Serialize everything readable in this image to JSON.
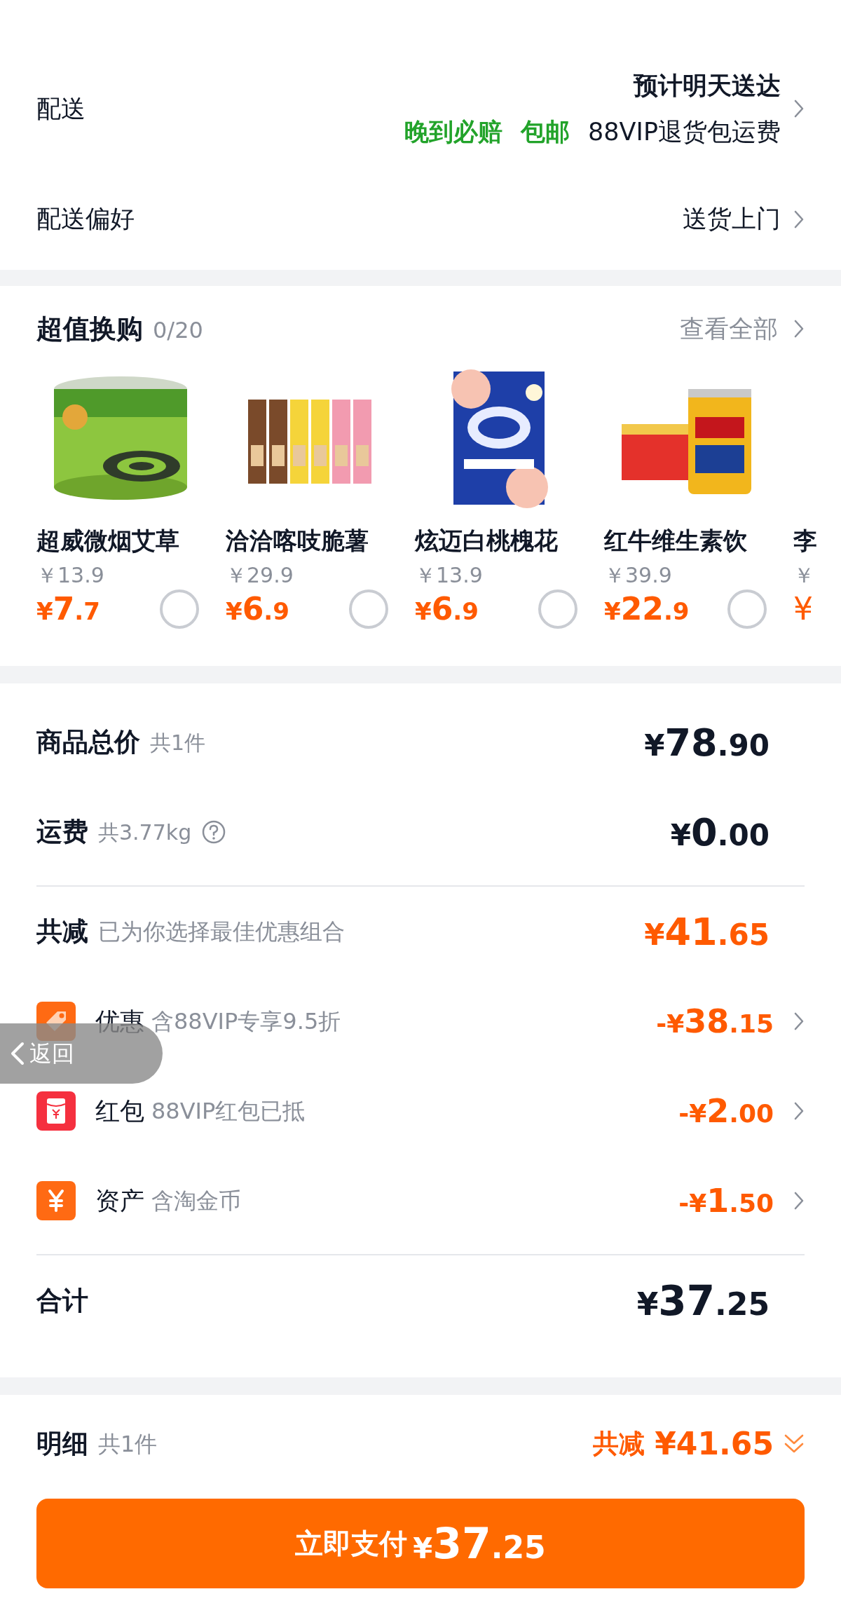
{
  "delivery": {
    "label": "配送",
    "estimate": "预计明天送达",
    "tags": [
      {
        "text": "晚到必赔",
        "kind": "highlight"
      },
      {
        "text": "包邮",
        "kind": "highlight"
      },
      {
        "text": "88VIP退货包运费",
        "kind": "plain"
      }
    ]
  },
  "preference": {
    "label": "配送偏好",
    "value": "送货上门"
  },
  "trade_in": {
    "title": "超值换购",
    "count": "0/20",
    "view_all": "查看全部",
    "items": [
      {
        "name": "超威微烟艾草",
        "old_price": "￥13.9",
        "price": "¥7.7",
        "selected": false
      },
      {
        "name": "洽洽喀吱脆薯",
        "old_price": "￥29.9",
        "price": "¥6.9",
        "selected": false
      },
      {
        "name": "炫迈白桃槐花",
        "old_price": "￥13.9",
        "price": "¥6.9",
        "selected": false
      },
      {
        "name": "红牛维生素饮",
        "old_price": "￥39.9",
        "price": "¥22.9",
        "selected": false
      },
      {
        "name": "李",
        "old_price": "￥",
        "price": "¥"
      }
    ]
  },
  "summary": {
    "rows": [
      {
        "label": "商品总价",
        "note": "共1件",
        "amount": "¥78.90",
        "help": false
      },
      {
        "label": "运费",
        "note": "共3.77kg",
        "amount": "¥0.00",
        "help": true
      }
    ],
    "savings": {
      "label": "共减",
      "note": "已为你选择最佳优惠组合",
      "amount": "¥41.65"
    },
    "discounts": [
      {
        "kind": "coupon",
        "label": "优惠",
        "note": "含88VIP专享9.5折",
        "amount": "-¥38.15"
      },
      {
        "kind": "red_packet",
        "label": "红包",
        "note": "88VIP红包已抵",
        "amount": "-¥2.00"
      },
      {
        "kind": "assets",
        "label": "资产",
        "note": "含淘金币",
        "amount": "-¥1.50"
      }
    ],
    "total": {
      "label": "合计",
      "amount": "¥37.25"
    }
  },
  "footer": {
    "label": "明细",
    "count": "共1件",
    "savings_label": "共减",
    "savings_amount": "¥41.65",
    "pay_label": "立即支付",
    "pay_amount": "¥37.25"
  },
  "back_button": {
    "label": "返回"
  }
}
